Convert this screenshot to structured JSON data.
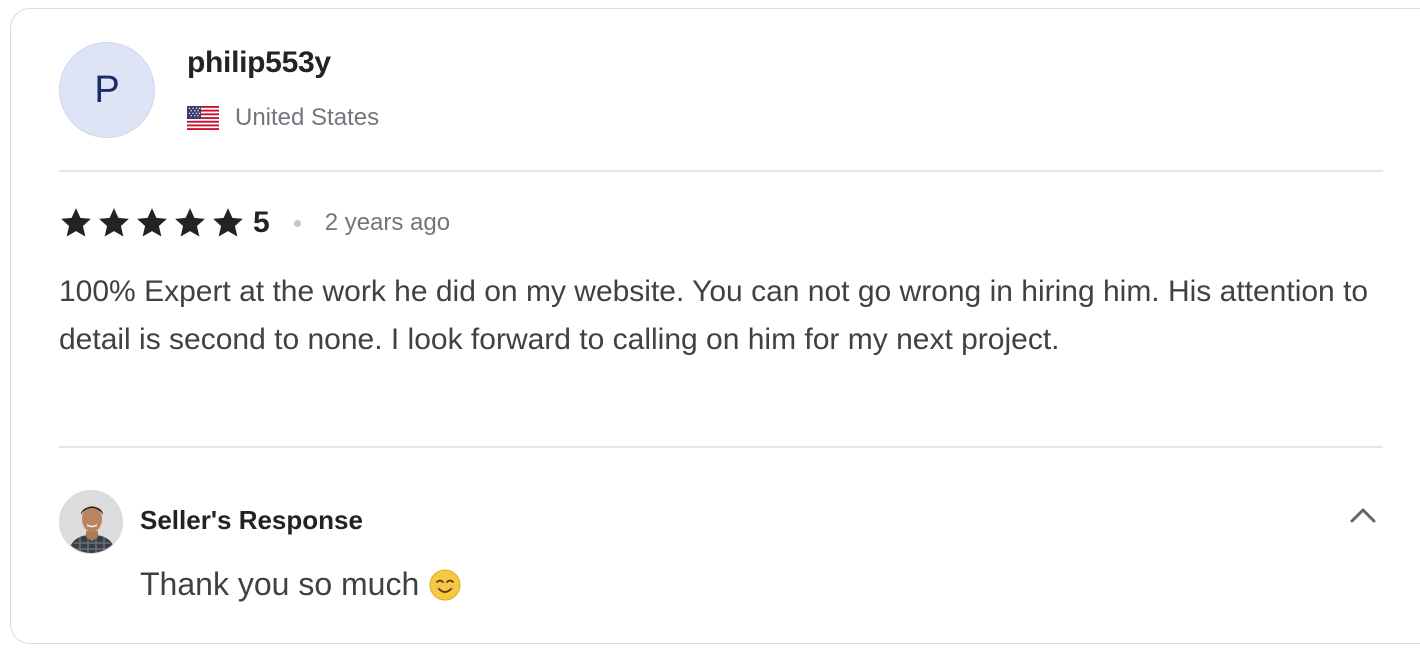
{
  "review": {
    "avatar_letter": "P",
    "username": "philip553y",
    "country": "United States",
    "rating": "5",
    "rating_stars": 5,
    "time_ago": "2 years ago",
    "text": "100% Expert at the work he did on my website. You can not go wrong in hiring him. His attention to detail is second to none. I look forward to calling on him for my next project."
  },
  "seller_response": {
    "title": "Seller's Response",
    "text": "Thank you so much"
  },
  "colors": {
    "avatar_bg": "#dfe3f6",
    "avatar_text": "#1d2b66",
    "star": "#222325",
    "muted_text": "#74767e",
    "divider": "#e4e5e7"
  },
  "icons": {
    "flag": "us-flag-icon",
    "star": "star-icon",
    "collapse": "chevron-up-icon",
    "emoji": "smiling-face-emoji-icon"
  }
}
